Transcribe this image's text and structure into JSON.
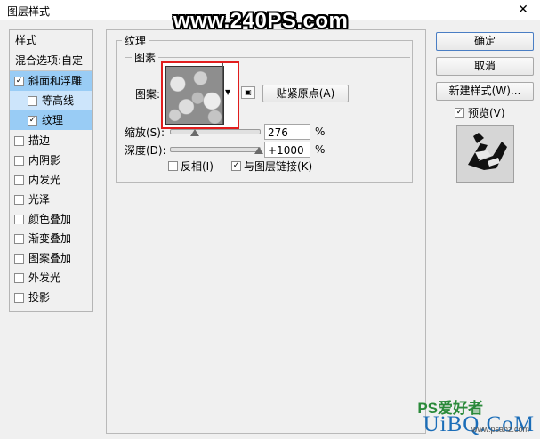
{
  "window": {
    "title": "图层样式",
    "close_glyph": "✕"
  },
  "watermark_top": "www.240PS.com",
  "left_panel": {
    "header": "样式",
    "blend_options": "混合选项:自定",
    "items": [
      {
        "label": "斜面和浮雕",
        "checked": true
      },
      {
        "label": "等高线",
        "checked": false
      },
      {
        "label": "纹理",
        "checked": true
      },
      {
        "label": "描边",
        "checked": false
      },
      {
        "label": "内阴影",
        "checked": false
      },
      {
        "label": "内发光",
        "checked": false
      },
      {
        "label": "光泽",
        "checked": false
      },
      {
        "label": "颜色叠加",
        "checked": false
      },
      {
        "label": "渐变叠加",
        "checked": false
      },
      {
        "label": "图案叠加",
        "checked": false
      },
      {
        "label": "外发光",
        "checked": false
      },
      {
        "label": "投影",
        "checked": false
      }
    ]
  },
  "texture": {
    "group_label": "纹理",
    "subgroup_label": "图素",
    "pattern_label": "图案:",
    "snap_button": "贴紧原点(A)",
    "scale_label": "缩放(S):",
    "scale_value": "276",
    "scale_unit": "%",
    "scale_fraction": 0.276,
    "depth_label": "深度(D):",
    "depth_value": "+1000",
    "depth_unit": "%",
    "depth_fraction": 1.0,
    "invert_label": "反相(I)",
    "invert_checked": false,
    "link_label": "与图层链接(K)",
    "link_checked": true
  },
  "right_panel": {
    "ok": "确定",
    "cancel": "取消",
    "new_style": "新建样式(W)...",
    "preview_label": "预览(V)",
    "preview_checked": true
  },
  "watermark_bottom": {
    "ps": "PS爱好者",
    "uibq": "UiBQ.CoM",
    "url": "www.psahz.com"
  },
  "colors": {
    "selection_dark": "#99ccf5",
    "selection_light": "#cde5fb",
    "highlight_red": "#e11d1d"
  }
}
